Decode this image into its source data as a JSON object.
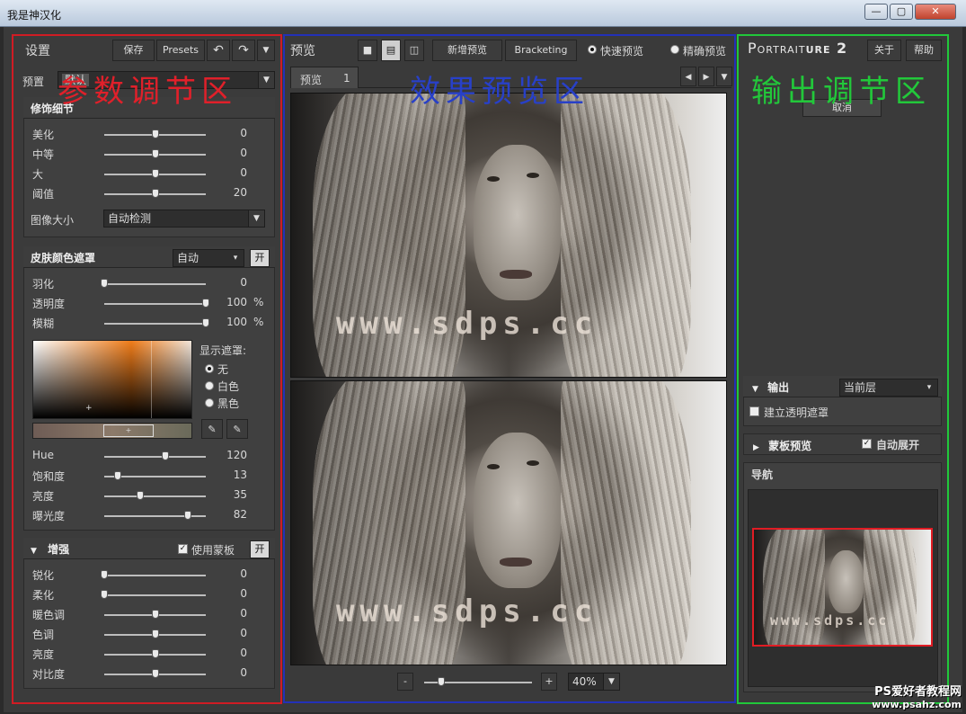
{
  "window": {
    "title": "我是神汉化",
    "min": "0",
    "max": "1",
    "close": "x"
  },
  "annotations": {
    "left": {
      "text": "参数调节区",
      "color": "#e0202a"
    },
    "center": {
      "text": "效果预览区",
      "color": "#2840c8"
    },
    "right": {
      "text": "输出调节区",
      "color": "#22c83a"
    }
  },
  "left": {
    "title": "设置",
    "save": "保存",
    "presets": "Presets",
    "preset_label": "预置",
    "preset_value": "默认",
    "detail": {
      "title": "修饰细节",
      "sliders": [
        {
          "label": "美化",
          "value": "0",
          "pct": 0.5
        },
        {
          "label": "中等",
          "value": "0",
          "pct": 0.5
        },
        {
          "label": "大",
          "value": "0",
          "pct": 0.5
        },
        {
          "label": "阈值",
          "value": "20",
          "pct": 0.5
        }
      ],
      "image_size_label": "图像大小",
      "image_size_value": "自动检测"
    },
    "skin": {
      "title": "皮肤颜色遮罩",
      "mode": "自动",
      "toggle": "开",
      "sliders": [
        {
          "label": "羽化",
          "value": "0",
          "pct": 0.0,
          "unit": ""
        },
        {
          "label": "透明度",
          "value": "100",
          "pct": 1.0,
          "unit": "%"
        },
        {
          "label": "模糊",
          "value": "100",
          "pct": 1.0,
          "unit": "%"
        }
      ],
      "show_mask_label": "显示遮罩:",
      "mask_options": [
        "无",
        "白色",
        "黑色"
      ],
      "hsl": [
        {
          "label": "Hue",
          "value": "120",
          "pct": 0.6
        },
        {
          "label": "饱和度",
          "value": "13",
          "pct": 0.13
        },
        {
          "label": "亮度",
          "value": "35",
          "pct": 0.35
        },
        {
          "label": "曝光度",
          "value": "82",
          "pct": 0.82
        }
      ]
    },
    "enhance": {
      "title": "增强",
      "use_mask": "使用蒙板",
      "toggle": "开",
      "sliders": [
        {
          "label": "锐化",
          "value": "0",
          "pct": 0.0
        },
        {
          "label": "柔化",
          "value": "0",
          "pct": 0.0
        },
        {
          "label": "暖色调",
          "value": "0",
          "pct": 0.5
        },
        {
          "label": "色调",
          "value": "0",
          "pct": 0.5
        },
        {
          "label": "亮度",
          "value": "0",
          "pct": 0.5
        },
        {
          "label": "对比度",
          "value": "0",
          "pct": 0.5
        }
      ]
    }
  },
  "center": {
    "title": "预览",
    "add_preview": "新增预览",
    "bracketing": "Bracketing",
    "fast_preview": "快速预览",
    "accurate_preview": "精确预览",
    "tab_label": "预览",
    "tab_num": "1",
    "watermark": "www.sdps.cc",
    "zoom_minus": "-",
    "zoom_plus": "+",
    "zoom_value": "40%"
  },
  "right": {
    "brand_a": "Portrait",
    "brand_b": "ure 2",
    "about": "关于",
    "help": "帮助",
    "cancel": "取消",
    "output_title": "输出",
    "output_target": "当前层",
    "transparency_mask": "建立透明遮罩",
    "mask_preview": "蒙板预览",
    "auto_expand": "自动展开",
    "navigator": "导航",
    "thumb_watermark": "www.sdps.cc"
  },
  "site_watermark": {
    "line1": "PS爱好者教程网",
    "line2": "www.psahz.com"
  }
}
